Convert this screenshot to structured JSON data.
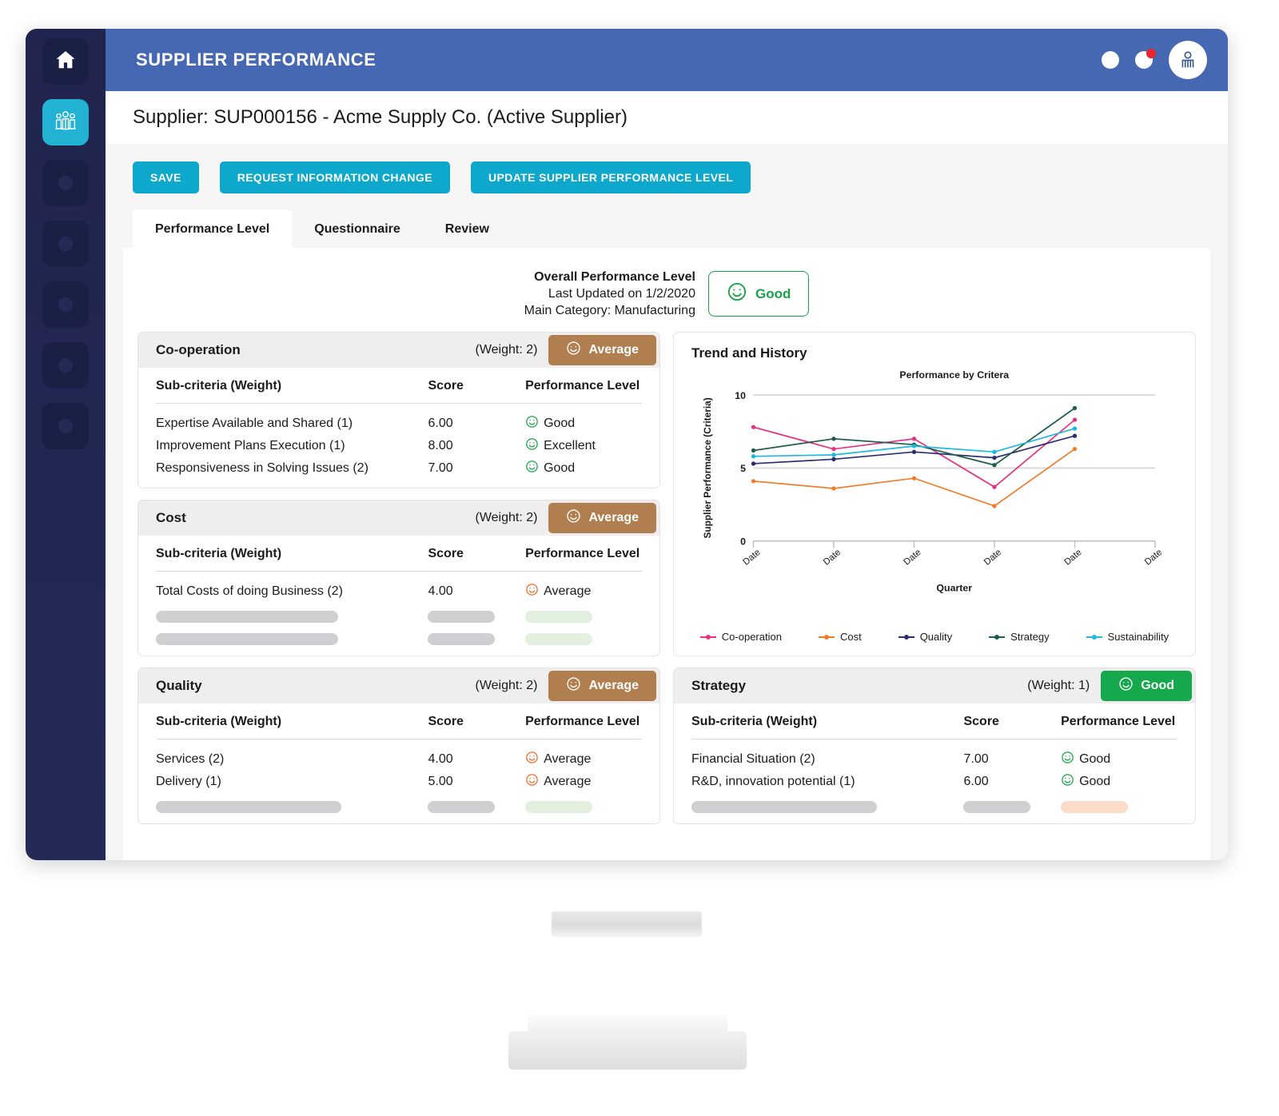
{
  "app": {
    "topbar_title": "SUPPLIER PERFORMANCE",
    "supplier_heading": "Supplier: SUP000156 - Acme Supply Co. (Active Supplier)"
  },
  "sidebar": {
    "items": [
      {
        "name": "home",
        "icon": "home-icon",
        "active": false
      },
      {
        "name": "suppliers",
        "icon": "people-group-icon",
        "active": true
      },
      {
        "name": "placeholder-1",
        "icon": "dot-icon",
        "active": false
      },
      {
        "name": "placeholder-2",
        "icon": "dot-icon",
        "active": false
      },
      {
        "name": "placeholder-3",
        "icon": "dot-icon",
        "active": false
      },
      {
        "name": "placeholder-4",
        "icon": "dot-icon",
        "active": false
      },
      {
        "name": "placeholder-5",
        "icon": "dot-icon",
        "active": false
      }
    ]
  },
  "header_icons": {
    "first": "circle-icon",
    "second": "notification-icon",
    "avatar": "user-avatar-icon"
  },
  "toolbar": {
    "save_label": "SAVE",
    "request_label": "REQUEST INFORMATION CHANGE",
    "update_label": "UPDATE SUPPLIER PERFORMANCE LEVEL"
  },
  "tabs": [
    {
      "label": "Performance Level",
      "active": true
    },
    {
      "label": "Questionnaire",
      "active": false
    },
    {
      "label": "Review",
      "active": false
    }
  ],
  "overall": {
    "title": "Overall Performance Level",
    "last_updated": "Last Updated on 1/2/2020",
    "main_category": "Main Category: Manufacturing",
    "badge_label": "Good",
    "badge_color": "#19a24a"
  },
  "table_headers": {
    "sub_criteria": "Sub-criteria (Weight)",
    "score": "Score",
    "performance_level": "Performance Level"
  },
  "colors": {
    "accent_button": "#0fa8cd",
    "topbar": "#4668b3",
    "badge_average": "#b17f4f",
    "badge_good": "#15a84c",
    "sidebar": "#20244e"
  },
  "cards": [
    {
      "title": "Co-operation",
      "weight": "(Weight: 2)",
      "badge_label": "Average",
      "badge_kind": "average",
      "rows": [
        {
          "sub": "Expertise Available and Shared (1)",
          "score": "6.00",
          "level": "Good",
          "level_kind": "good"
        },
        {
          "sub": "Improvement Plans Execution (1)",
          "score": "8.00",
          "level": "Excellent",
          "level_kind": "good"
        },
        {
          "sub": "Responsiveness in Solving Issues (2)",
          "score": "7.00",
          "level": "Good",
          "level_kind": "good"
        }
      ],
      "skeletons": 0
    },
    {
      "title": "Cost",
      "weight": "(Weight: 2)",
      "badge_label": "Average",
      "badge_kind": "average",
      "rows": [
        {
          "sub": "Total Costs of doing Business (2)",
          "score": "4.00",
          "level": "Average",
          "level_kind": "average"
        }
      ],
      "skeletons": 2
    },
    {
      "title": "Quality",
      "weight": "(Weight: 2)",
      "badge_label": "Average",
      "badge_kind": "average",
      "rows": [
        {
          "sub": "Services (2)",
          "score": "4.00",
          "level": "Average",
          "level_kind": "average"
        },
        {
          "sub": "Delivery (1)",
          "score": "5.00",
          "level": "Average",
          "level_kind": "average"
        }
      ],
      "skeletons": 1
    },
    {
      "title": "Strategy",
      "weight": "(Weight: 1)",
      "badge_label": "Good",
      "badge_kind": "good",
      "rows": [
        {
          "sub": "Financial Situation (2)",
          "score": "7.00",
          "level": "Good",
          "level_kind": "good"
        },
        {
          "sub": "R&D, innovation potential (1)",
          "score": "6.00",
          "level": "Good",
          "level_kind": "good"
        }
      ],
      "skeletons": 1,
      "skeleton_tint": "peach"
    }
  ],
  "trend": {
    "panel_title": "Trend and History"
  },
  "chart_data": {
    "type": "line",
    "title": "Performance by Critera",
    "xlabel": "Quarter",
    "ylabel": "Supplier Performance (Criteria)",
    "ylim": [
      0,
      10
    ],
    "yticks": [
      0,
      5,
      10
    ],
    "grid": true,
    "legend_position": "bottom",
    "categories": [
      "Date",
      "Date",
      "Date",
      "Date",
      "Date",
      "Date"
    ],
    "x": [
      1,
      2,
      3,
      4,
      5
    ],
    "series": [
      {
        "name": "Co-operation",
        "color": "#e5337f",
        "values": [
          7.8,
          6.3,
          7.0,
          3.7,
          8.3
        ]
      },
      {
        "name": "Cost",
        "color": "#ef7d2c",
        "values": [
          4.1,
          3.6,
          4.3,
          2.4,
          6.3
        ]
      },
      {
        "name": "Quality",
        "color": "#2e2d6e",
        "values": [
          5.3,
          5.6,
          6.1,
          5.7,
          7.2
        ]
      },
      {
        "name": "Strategy",
        "color": "#1d5c4f",
        "values": [
          6.2,
          7.0,
          6.6,
          5.2,
          9.1
        ]
      },
      {
        "name": "Sustainability",
        "color": "#1fb8e0",
        "values": [
          5.8,
          5.9,
          6.5,
          6.1,
          7.7
        ]
      }
    ]
  }
}
